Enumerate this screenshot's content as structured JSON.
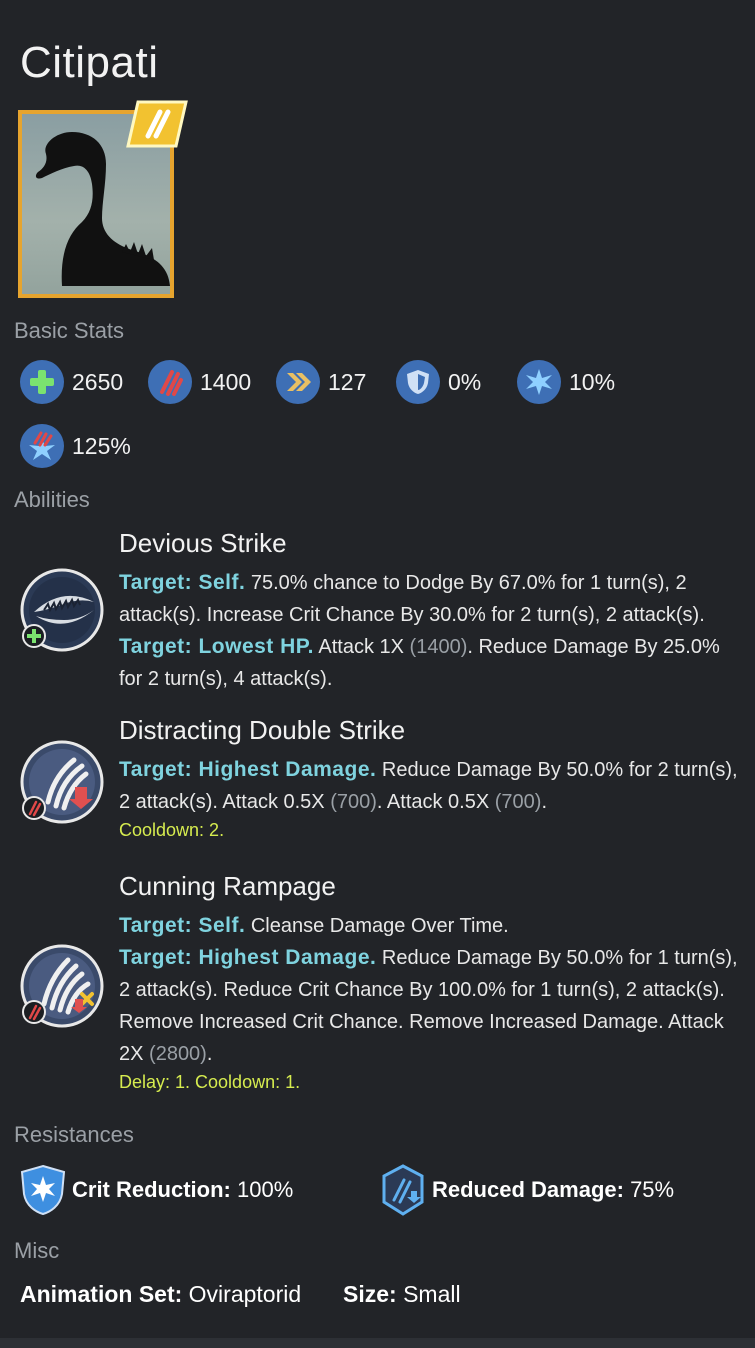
{
  "title": "Citipati",
  "sections": {
    "basic_stats": "Basic Stats",
    "abilities": "Abilities",
    "resistances": "Resistances",
    "misc": "Misc"
  },
  "stats": {
    "health": "2650",
    "damage": "1400",
    "speed": "127",
    "armor": "0%",
    "crit_chance": "10%",
    "crit_multiplier": "125%"
  },
  "abilities": [
    {
      "name": "Devious Strike",
      "icon": "jaws-icon",
      "l1_target": "Target: Self.",
      "l1_text": " 75.0% chance to Dodge By 67.0% for 1 turn(s), 2 attack(s). Increase Crit Chance By 30.0% for 2 turn(s), 2 attack(s).",
      "l2_target": "Target: Lowest HP.",
      "l2_a": " Attack 1X ",
      "l2_dim": "(1400)",
      "l2_b": ". Reduce Damage By 25.0% for 2 turn(s), 4 attack(s)."
    },
    {
      "name": "Distracting Double Strike",
      "icon": "claw-icon",
      "l1_target": "Target: Highest Damage.",
      "l1_a": " Reduce Damage By 50.0% for 2 turn(s), 2 attack(s). Attack 0.5X ",
      "l1_dim1": "(700)",
      "l1_b": ". Attack 0.5X ",
      "l1_dim2": "(700)",
      "l1_c": ".",
      "cooldown": "Cooldown: 2."
    },
    {
      "name": "Cunning Rampage",
      "icon": "claw-icon",
      "l1_target": "Target: Self.",
      "l1_text": " Cleanse Damage Over Time.",
      "l2_target": "Target: Highest Damage.",
      "l2_a": " Reduce Damage By 50.0% for 1 turn(s), 2 attack(s). Reduce Crit Chance By 100.0% for 1 turn(s), 2 attack(s). Remove Increased Crit Chance. Remove Increased Damage. Attack 2X ",
      "l2_dim": "(2800)",
      "l2_b": ".",
      "cooldown": "Delay: 1. Cooldown: 1."
    }
  ],
  "resistances": [
    {
      "label": "Crit Reduction:",
      "value": " 100%"
    },
    {
      "label": "Reduced Damage:",
      "value": " 75%"
    }
  ],
  "misc": {
    "animation_label": "Animation Set:",
    "animation_value": " Oviraptorid",
    "size_label": "Size:",
    "size_value": " Small"
  },
  "colors": {
    "background": "#222428",
    "target_text": "#7fd3df",
    "cooldown_text": "#d6ec4f",
    "portrait_border": "#e6a42e",
    "stat_icon_bg": "#3e6fb5"
  }
}
